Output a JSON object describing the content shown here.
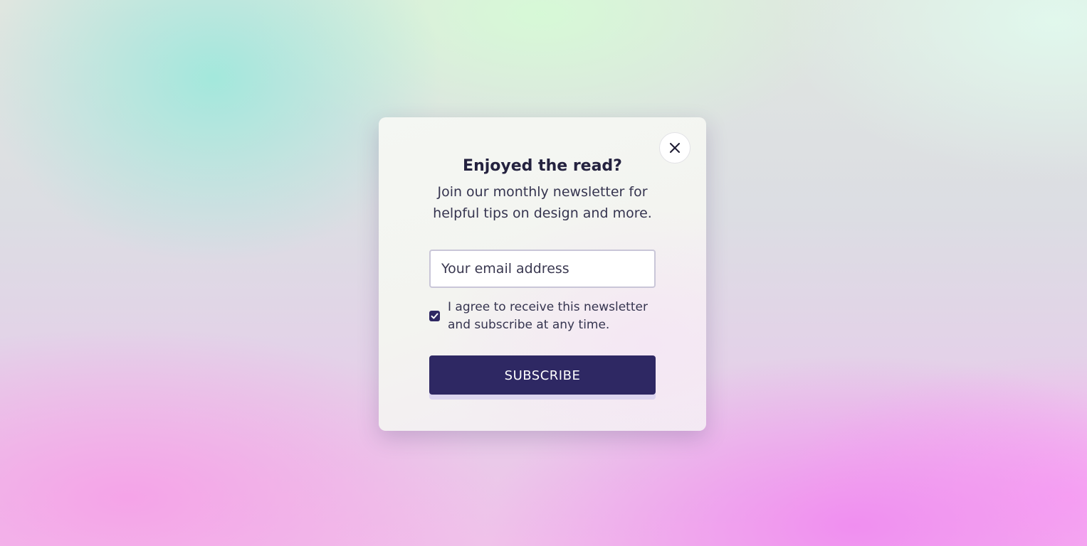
{
  "modal": {
    "title": "Enjoyed the read?",
    "subtitle": "Join our monthly newsletter for helpful tips on design and more.",
    "close_icon": "close-icon",
    "email_field": {
      "value": "",
      "placeholder": "Your email address"
    },
    "consent": {
      "checked": true,
      "label": "I agree to receive this newsletter and subscribe at any time."
    },
    "subscribe_label": "SUBSCRIBE"
  },
  "colors": {
    "primary": "#2e2863",
    "title_text": "#24223f",
    "body_text": "#35344f",
    "input_border": "#c9c6d8",
    "card_background": "#f3f4f0"
  }
}
